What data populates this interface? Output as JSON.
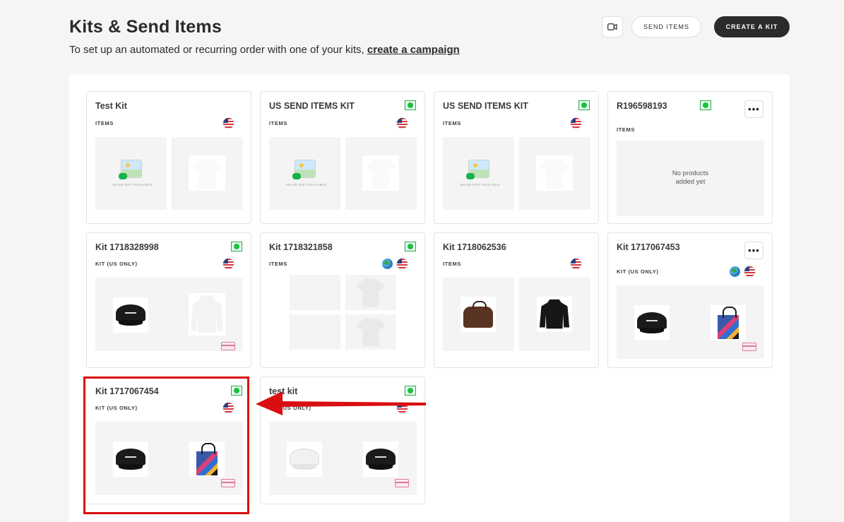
{
  "header": {
    "title": "Kits & Send Items",
    "subtitle_prefix": "To set up an automated or recurring order with one of your kits,",
    "subtitle_link": "create a campaign",
    "video_icon": "video-camera-icon",
    "send_items_label": "SEND ITEMS",
    "create_kit_label": "CREATE A KIT"
  },
  "kits": [
    {
      "title": "Test Kit",
      "subtitle": "ITEMS",
      "active": false,
      "regions": [
        "us-flag-icon"
      ],
      "menu": false
    },
    {
      "title": "US SEND ITEMS KIT",
      "subtitle": "ITEMS",
      "active": true,
      "regions": [
        "us-flag-icon"
      ],
      "menu": false
    },
    {
      "title": "US SEND ITEMS KIT",
      "subtitle": "ITEMS",
      "active": true,
      "regions": [
        "us-flag-icon"
      ],
      "menu": false
    },
    {
      "title": "R196598193",
      "subtitle": "ITEMS",
      "active": true,
      "regions": [],
      "menu": true,
      "empty_line1": "No products",
      "empty_line2": "added yet"
    },
    {
      "title": "Kit 1718328998",
      "subtitle": "KIT (US ONLY)",
      "active": true,
      "regions": [
        "us-flag-icon"
      ],
      "menu": false
    },
    {
      "title": "Kit 1718321858",
      "subtitle": "ITEMS",
      "active": true,
      "regions": [
        "globe-icon",
        "us-flag-icon"
      ],
      "menu": false
    },
    {
      "title": "Kit 1718062536",
      "subtitle": "ITEMS",
      "active": false,
      "regions": [
        "us-flag-icon"
      ],
      "menu": false
    },
    {
      "title": "Kit 1717067453",
      "subtitle": "KIT (US ONLY)",
      "active": false,
      "regions": [
        "globe-icon",
        "us-flag-icon"
      ],
      "menu": true
    },
    {
      "title": "Kit 1717067454",
      "subtitle": "KIT (US ONLY)",
      "active": true,
      "regions": [
        "us-flag-icon"
      ],
      "menu": false
    },
    {
      "title": "test kit",
      "subtitle": "KIT (US ONLY)",
      "active": true,
      "regions": [
        "us-flag-icon"
      ],
      "menu": false
    }
  ],
  "placeholder_text": "IMAGE NOT AVAILABLE",
  "more_menu_glyph": "•••",
  "colors": {
    "active_green": "#19c23f",
    "primary_dark": "#2b2b2b",
    "annotation_red": "#d90e12"
  },
  "annotation": {
    "type": "red-arrow-highlight",
    "target": "Kit 1717067454"
  }
}
